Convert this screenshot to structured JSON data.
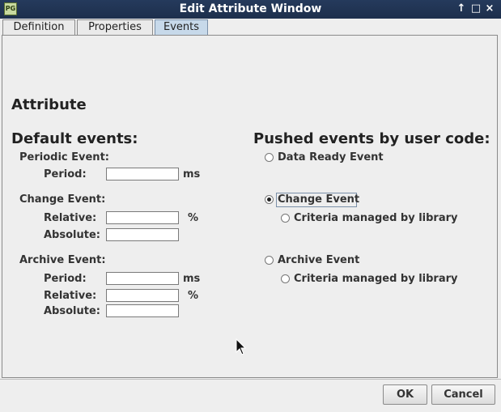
{
  "window": {
    "title": "Edit Attribute Window",
    "app_icon_text": "PG"
  },
  "titlebar_buttons": {
    "up": "↑",
    "restore": "□",
    "close": "×"
  },
  "tabs": [
    {
      "label": "Definition"
    },
    {
      "label": "Properties"
    },
    {
      "label": "Events"
    }
  ],
  "section_title": "Attribute",
  "default_events": {
    "title": "Default events:",
    "periodic": {
      "label": "Periodic Event:",
      "period_label": "Period:",
      "period_unit": "ms",
      "period_value": ""
    },
    "change": {
      "label": "Change Event:",
      "relative_label": "Relative:",
      "relative_unit": "%",
      "relative_value": "",
      "absolute_label": "Absolute:",
      "absolute_value": ""
    },
    "archive": {
      "label": "Archive Event:",
      "period_label": "Period:",
      "period_unit": "ms",
      "period_value": "",
      "relative_label": "Relative:",
      "relative_unit": "%",
      "relative_value": "",
      "absolute_label": "Absolute:",
      "absolute_value": ""
    }
  },
  "pushed_events": {
    "title": "Pushed events by user code:",
    "data_ready": {
      "label": "Data Ready Event",
      "selected": false
    },
    "change": {
      "label": "Change Event",
      "selected": true,
      "criteria_label": "Criteria managed by library",
      "criteria_selected": false
    },
    "archive": {
      "label": "Archive Event",
      "selected": false,
      "criteria_label": "Criteria managed by library",
      "criteria_selected": false
    }
  },
  "footer": {
    "ok_label": "OK",
    "cancel_label": "Cancel"
  }
}
